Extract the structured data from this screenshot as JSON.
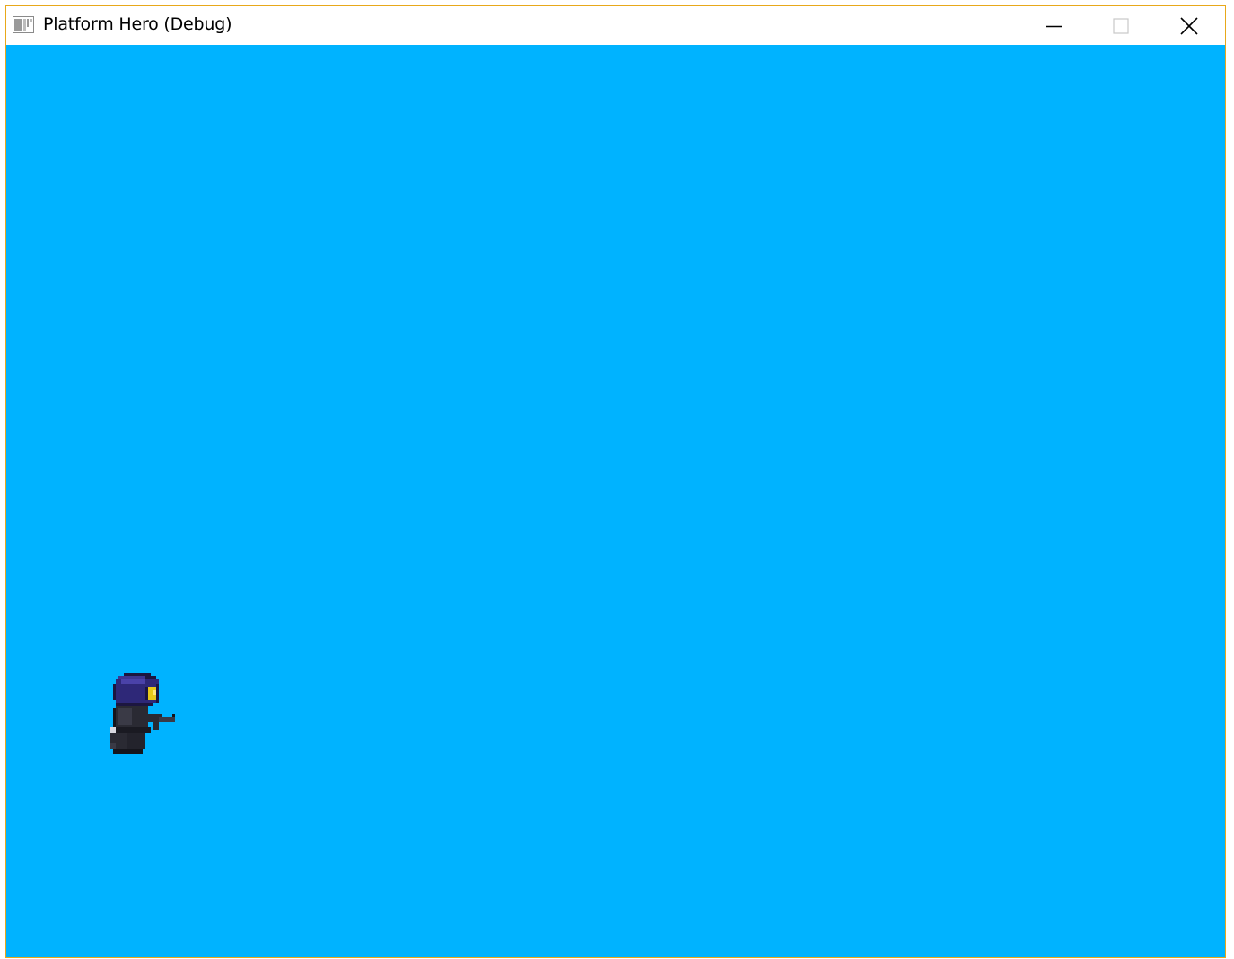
{
  "window": {
    "title": "Platform Hero (Debug)",
    "border_color": "#e8a81a",
    "controls": {
      "minimize": "minimize-icon",
      "maximize": "maximize-icon",
      "close": "close-icon"
    }
  },
  "game": {
    "background_color": "#00b3ff",
    "player": {
      "sprite": "hero-sprite",
      "facing": "right",
      "weapon": "gun"
    }
  }
}
